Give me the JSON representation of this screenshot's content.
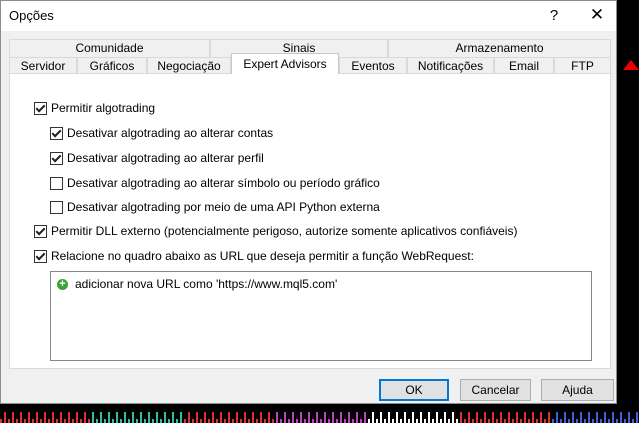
{
  "window": {
    "title": "Opções",
    "help_glyph": "?",
    "close_glyph": "✕"
  },
  "tabs_row1": [
    "Comunidade",
    "Sinais",
    "Armazenamento"
  ],
  "tabs_row2": [
    "Servidor",
    "Gráficos",
    "Negociação",
    "Expert Advisors",
    "Eventos",
    "Notificações",
    "Email",
    "FTP"
  ],
  "active_tab": "Expert Advisors",
  "options": [
    {
      "label": "Permitir algotrading",
      "checked": true
    },
    {
      "label": "Desativar algotrading ao alterar contas",
      "checked": true
    },
    {
      "label": "Desativar algotrading ao alterar perfil",
      "checked": true
    },
    {
      "label": "Desativar algotrading ao alterar símbolo ou período gráfico",
      "checked": false
    },
    {
      "label": "Desativar algotrading por meio de uma API Python externa",
      "checked": false
    },
    {
      "label": "Permitir DLL externo (potencialmente perigoso, autorize somente aplicativos confiáveis)",
      "checked": true
    },
    {
      "label": "Relacione no quadro abaixo as URL que deseja permitir a função WebRequest:",
      "checked": true
    }
  ],
  "url_list": {
    "add_label": "adicionar nova URL como 'https://www.mql5.com'",
    "add_icon": "plus-circle-icon"
  },
  "buttons": {
    "ok": "OK",
    "cancel": "Cancelar",
    "help": "Ajuda"
  },
  "colors": {
    "accent": "#0078d7",
    "add_icon": "#3aa335"
  }
}
